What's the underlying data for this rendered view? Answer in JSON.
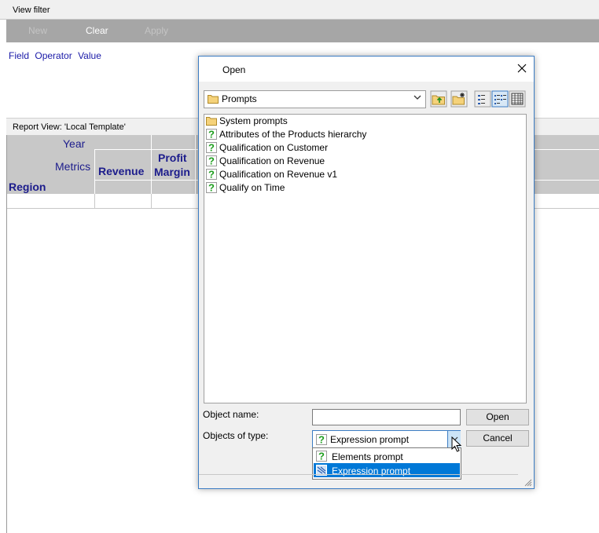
{
  "view_filter": {
    "title": "View filter",
    "buttons": {
      "new": "New",
      "clear": "Clear",
      "apply": "Apply"
    },
    "columns": [
      "Field",
      "Operator",
      "Value"
    ]
  },
  "report_view": {
    "title": "Report View: 'Local Template'",
    "grid": {
      "col_attribute": "Year",
      "row_header": "Metrics",
      "row_attribute": "Region",
      "metrics": [
        "Revenue",
        "Profit Margin"
      ],
      "profit_line1": "Profit",
      "profit_line2": "Margin"
    }
  },
  "dialog": {
    "title": "Open",
    "look_in": "Prompts",
    "items": [
      {
        "label": "System prompts",
        "icon": "folder-icon"
      },
      {
        "label": "Attributes of the Products hierarchy",
        "icon": "prompt-icon"
      },
      {
        "label": "Qualification on Customer",
        "icon": "prompt-icon"
      },
      {
        "label": "Qualification on Revenue",
        "icon": "prompt-icon"
      },
      {
        "label": "Qualification on Revenue v1",
        "icon": "prompt-icon"
      },
      {
        "label": "Qualify on Time",
        "icon": "prompt-icon"
      }
    ],
    "object_name_label": "Object name:",
    "object_name_value": "",
    "objects_of_type_label": "Objects of type:",
    "objects_of_type_value": "Expression prompt",
    "type_options": [
      "Elements prompt",
      "Expression prompt"
    ],
    "open_button": "Open",
    "cancel_button": "Cancel"
  }
}
